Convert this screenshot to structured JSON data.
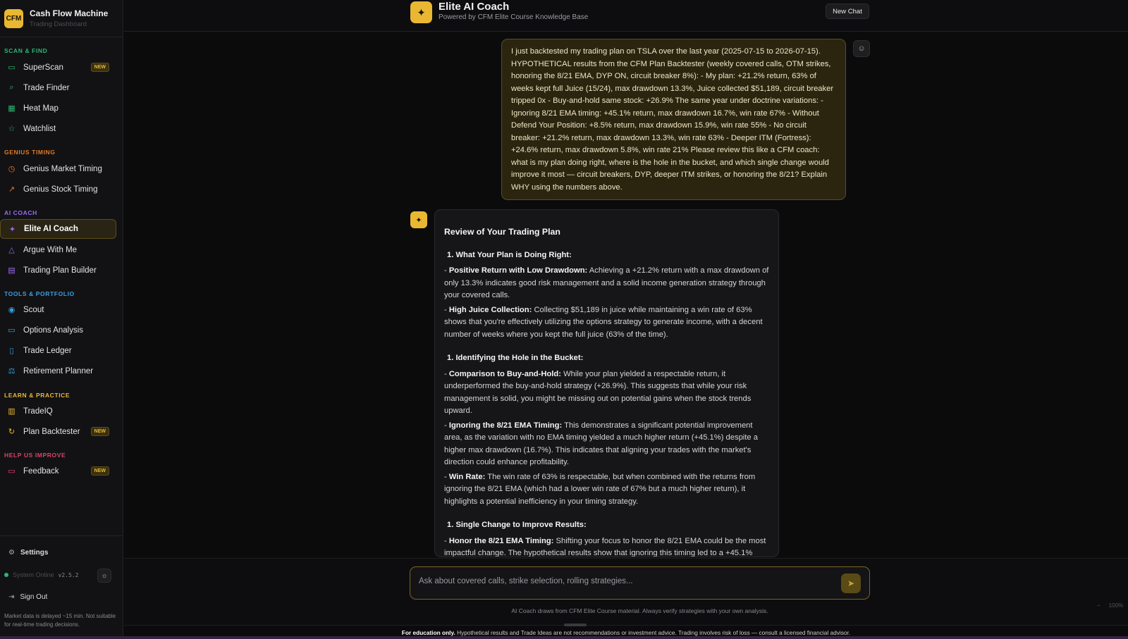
{
  "brand": {
    "logo": "CFM",
    "title": "Cash Flow Machine",
    "subtitle": "Trading Dashboard"
  },
  "sidebar": {
    "sections": [
      {
        "label": "SCAN & FIND",
        "color": "#2bb673"
      },
      {
        "label": "GENIUS TIMING",
        "color": "#e07a2a"
      },
      {
        "label": "AI COACH",
        "color": "#9b6bf2"
      },
      {
        "label": "TOOLS & PORTFOLIO",
        "color": "#3aa0e0"
      },
      {
        "label": "LEARN & PRACTICE",
        "color": "#e9b731"
      },
      {
        "label": "HELP US IMPROVE",
        "color": "#e0416b"
      }
    ],
    "items": [
      {
        "label": "SuperScan",
        "icon": "monitor-icon",
        "badge": "NEW"
      },
      {
        "label": "Trade Finder",
        "icon": "search-icon"
      },
      {
        "label": "Heat Map",
        "icon": "grid-icon"
      },
      {
        "label": "Watchlist",
        "icon": "star-icon"
      },
      {
        "label": "Genius Market Timing",
        "icon": "clock-icon"
      },
      {
        "label": "Genius Stock Timing",
        "icon": "trend-up-icon"
      },
      {
        "label": "Elite AI Coach",
        "icon": "sparkles-icon",
        "active": true
      },
      {
        "label": "Argue With Me",
        "icon": "warning-triangle-icon"
      },
      {
        "label": "Trading Plan Builder",
        "icon": "clipboard-icon"
      },
      {
        "label": "Scout",
        "icon": "eye-icon"
      },
      {
        "label": "Options Analysis",
        "icon": "chart-monitor-icon"
      },
      {
        "label": "Trade Ledger",
        "icon": "book-icon"
      },
      {
        "label": "Retirement Planner",
        "icon": "scale-icon"
      },
      {
        "label": "TradeIQ",
        "icon": "bar-chart-icon"
      },
      {
        "label": "Plan Backtester",
        "icon": "refresh-icon",
        "badge": "NEW"
      },
      {
        "label": "Feedback",
        "icon": "message-icon",
        "badge": "NEW"
      }
    ],
    "settings": "Settings",
    "status": "System Online",
    "version": "v2.5.2",
    "signout": "Sign Out",
    "disclaimer": "Market data is delayed ~15 min. Not suitable for real-time trading decisions."
  },
  "header": {
    "title": "Elite AI Coach",
    "subtitle": "Powered by CFM Elite Course Knowledge Base",
    "new_chat": "New Chat"
  },
  "chat": {
    "user_message": "I just backtested my trading plan on TSLA over the last year (2025-07-15 to 2026-07-15). HYPOTHETICAL results from the CFM Plan Backtester (weekly covered calls, OTM strikes, honoring the 8/21 EMA, DYP ON, circuit breaker 8%): - My plan: +21.2% return, 63% of weeks kept full Juice (15/24), max drawdown 13.3%, Juice collected $51,189, circuit breaker tripped 0x - Buy-and-hold same stock: +26.9% The same year under doctrine variations: - Ignoring 8/21 EMA timing: +45.1% return, max drawdown 16.7%, win rate 67% - Without Defend Your Position: +8.5% return, max drawdown 15.9%, win rate 55% - No circuit breaker: +21.2% return, max drawdown 13.3%, win rate 63% - Deeper ITM (Fortress): +24.6% return, max drawdown 5.8%, win rate 21% Please review this like a CFM coach: what is my plan doing right, where is the hole in the bucket, and which single change would improve it most — circuit breakers, DYP, deeper ITM strikes, or honoring the 8/21? Explain WHY using the numbers above.",
    "reply": {
      "title": "Review of Your Trading Plan",
      "sections": [
        {
          "heading": "What Your Plan is Doing Right:",
          "points": [
            {
              "label": "Positive Return with Low Drawdown:",
              "text": "Achieving a +21.2% return with a max drawdown of only 13.3% indicates good risk management and a solid income generation strategy through your covered calls."
            },
            {
              "label": "High Juice Collection:",
              "text": "Collecting $51,189 in juice while maintaining a win rate of 63% shows that you're effectively utilizing the options strategy to generate income, with a decent number of weeks where you kept the full juice (63% of the time)."
            }
          ]
        },
        {
          "heading": "Identifying the Hole in the Bucket:",
          "points": [
            {
              "label": "Comparison to Buy-and-Hold:",
              "text": "While your plan yielded a respectable return, it underperformed the buy-and-hold strategy (+26.9%). This suggests that while your risk management is solid, you might be missing out on potential gains when the stock trends upward."
            },
            {
              "label": "Ignoring the 8/21 EMA Timing:",
              "text": "This demonstrates a significant potential improvement area, as the variation with no EMA timing yielded a much higher return (+45.1%) despite a higher max drawdown (16.7%). This indicates that aligning your trades with the market's direction could enhance profitability."
            },
            {
              "label": "Win Rate:",
              "text": "The win rate of 63% is respectable, but when combined with the returns from ignoring the 8/21 EMA (which had a lower win rate of 67% but a much higher return), it highlights a potential inefficiency in your timing strategy."
            }
          ]
        },
        {
          "heading": "Single Change to Improve Results:",
          "points": [
            {
              "label": "Honor the 8/21 EMA Timing:",
              "text": "Shifting your focus to honor the 8/21 EMA could be the most impactful change. The hypothetical results show that ignoring this timing led to a +45.1%"
            }
          ]
        }
      ]
    }
  },
  "input": {
    "placeholder": "Ask about covered calls, strike selection, rolling strategies...",
    "note": "AI Coach draws from CFM Elite Course material. Always verify strategies with your own analysis."
  },
  "zoom": {
    "minus": "−",
    "level": "100%"
  },
  "banner": {
    "bold": "For education only.",
    "text": " Hypothetical results and Trade Ideas are not recommendations or investment advice. Trading involves risk of loss — consult a licensed financial advisor."
  },
  "colors": {
    "accent": "#e9b731",
    "background": "#0b0b0c",
    "sidebar": "#121214"
  }
}
